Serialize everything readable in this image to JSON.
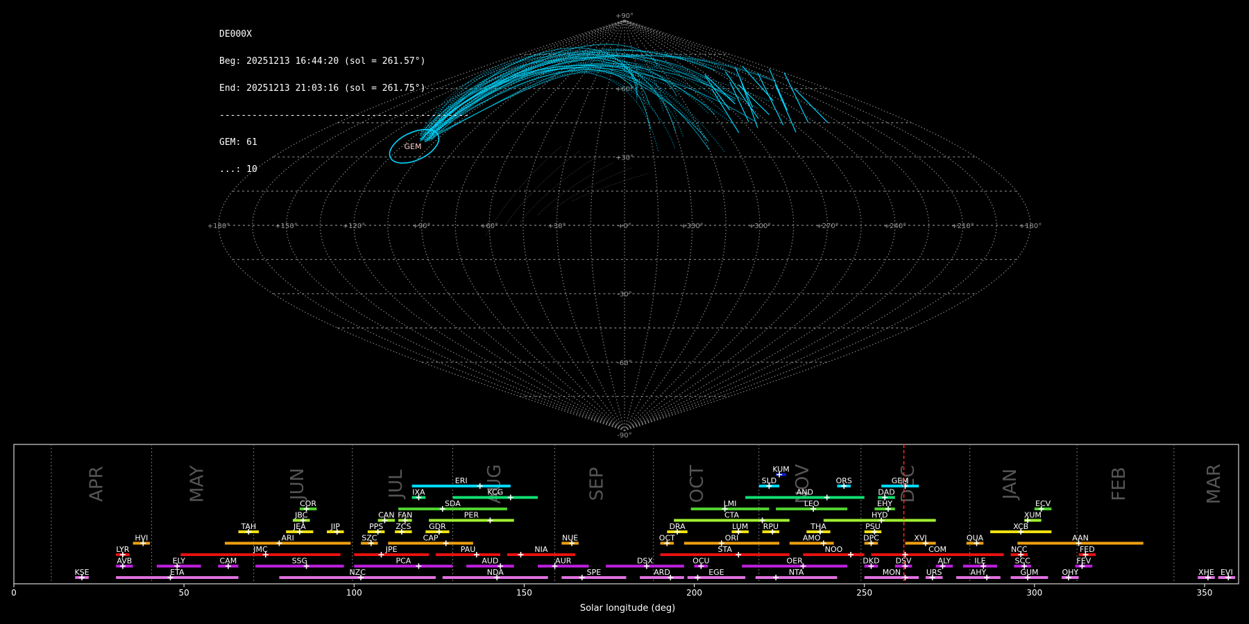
{
  "info": {
    "station": "DE000X",
    "beg": "Beg: 20251213 16:44:20 (sol = 261.57°)",
    "end": "End: 20251213 21:03:16 (sol = 261.75°)",
    "separator": "----------------------------------------------",
    "count_gem": "GEM: 61",
    "count_other": "...: 10"
  },
  "colors": {
    "background": "#000000",
    "meteor": "#00d8ff",
    "grid": "#888888",
    "now_line": "#ff2020",
    "timeline_text": "#ffffff",
    "month_label": "#555555"
  },
  "chart_data": [
    {
      "type": "scatter",
      "title": "",
      "projection": "sinusoidal",
      "lon_labels": [
        "+180°",
        "+150°",
        "+120°",
        "+90°",
        "+60°",
        "+30°",
        "+0°",
        "+330°",
        "+300°",
        "+270°",
        "+240°",
        "+210°",
        "+180°"
      ],
      "lat_labels": [
        "+90°",
        "+60°",
        "+30°",
        "-30°",
        "-60°",
        "-90°"
      ],
      "radiant": {
        "name": "GEM",
        "lon": 112,
        "lat": 33
      },
      "grid": true
    },
    {
      "type": "bar",
      "xlabel": "Solar longitude (deg)",
      "xlim": [
        0,
        360
      ],
      "xticks": [
        0,
        50,
        100,
        150,
        200,
        250,
        300,
        350
      ],
      "current_sol": 261.6,
      "months": [
        {
          "name": "APR",
          "x": 24.5
        },
        {
          "name": "MAY",
          "x": 54
        },
        {
          "name": "JUN",
          "x": 83.5
        },
        {
          "name": "JUL",
          "x": 112.5
        },
        {
          "name": "AUG",
          "x": 141.5
        },
        {
          "name": "SEP",
          "x": 171.5
        },
        {
          "name": "OCT",
          "x": 201
        },
        {
          "name": "NOV",
          "x": 232
        },
        {
          "name": "DEC",
          "x": 263
        },
        {
          "name": "JAN",
          "x": 293
        },
        {
          "name": "FEB",
          "x": 325
        },
        {
          "name": "MAR",
          "x": 353
        }
      ],
      "month_boundaries": [
        11,
        40.5,
        70.5,
        99.5,
        129,
        159,
        188,
        219,
        249,
        281,
        312.5,
        341
      ],
      "showers": [
        {
          "code": "KUM",
          "start": 224,
          "end": 227,
          "peak": 225,
          "row": 9,
          "color": "#0a1ed0"
        },
        {
          "code": "ERI",
          "start": 117,
          "end": 146,
          "peak": 137,
          "row": 8,
          "color": "#00d8ff"
        },
        {
          "code": "SLD",
          "start": 219,
          "end": 225,
          "peak": 222,
          "row": 8,
          "color": "#00d8ff"
        },
        {
          "code": "ORS",
          "start": 242,
          "end": 246,
          "peak": 244,
          "row": 8,
          "color": "#00d8ff"
        },
        {
          "code": "GEM",
          "start": 255,
          "end": 266,
          "peak": 262,
          "row": 8,
          "color": "#00d8ff"
        },
        {
          "code": "IXA",
          "start": 117,
          "end": 121,
          "peak": 119,
          "row": 7,
          "color": "#10e070"
        },
        {
          "code": "KCG",
          "start": 129,
          "end": 154,
          "peak": 146,
          "row": 7,
          "color": "#10e070"
        },
        {
          "code": "AND",
          "start": 215,
          "end": 250,
          "peak": 239,
          "row": 7,
          "color": "#10e070"
        },
        {
          "code": "DAD",
          "start": 254,
          "end": 259,
          "peak": 256,
          "row": 7,
          "color": "#10e070"
        },
        {
          "code": "COR",
          "start": 84,
          "end": 89,
          "peak": 86,
          "row": 6,
          "color": "#50d030"
        },
        {
          "code": "SDA",
          "start": 113,
          "end": 145,
          "peak": 126,
          "row": 6,
          "color": "#50d030"
        },
        {
          "code": "LMI",
          "start": 199,
          "end": 222,
          "peak": 209,
          "row": 6,
          "color": "#50d030"
        },
        {
          "code": "LEO",
          "start": 224,
          "end": 245,
          "peak": 235,
          "row": 6,
          "color": "#50d030"
        },
        {
          "code": "EHY",
          "start": 253,
          "end": 259,
          "peak": 257,
          "row": 6,
          "color": "#50d030"
        },
        {
          "code": "ECV",
          "start": 300,
          "end": 305,
          "peak": 302,
          "row": 6,
          "color": "#50d030"
        },
        {
          "code": "JBC",
          "start": 82,
          "end": 87,
          "peak": 85,
          "row": 5,
          "color": "#a0f030"
        },
        {
          "code": "CAN",
          "start": 107,
          "end": 112,
          "peak": 109,
          "row": 5,
          "color": "#a0f030"
        },
        {
          "code": "FAN",
          "start": 113,
          "end": 117,
          "peak": 115,
          "row": 5,
          "color": "#a0f030"
        },
        {
          "code": "PER",
          "start": 122,
          "end": 147,
          "peak": 140,
          "row": 5,
          "color": "#a0f030"
        },
        {
          "code": "CTA",
          "start": 194,
          "end": 228,
          "peak": 220,
          "row": 5,
          "color": "#a0f030"
        },
        {
          "code": "HYD",
          "start": 238,
          "end": 271,
          "peak": 255,
          "row": 5,
          "color": "#a0f030"
        },
        {
          "code": "XUM",
          "start": 297,
          "end": 302,
          "peak": 298,
          "row": 5,
          "color": "#a0f030"
        },
        {
          "code": "TAH",
          "start": 66,
          "end": 72,
          "peak": 69,
          "row": 4,
          "color": "#f0e010"
        },
        {
          "code": "JEA",
          "start": 80,
          "end": 88,
          "peak": 84,
          "row": 4,
          "color": "#f0e010"
        },
        {
          "code": "JIP",
          "start": 92,
          "end": 97,
          "peak": 95,
          "row": 4,
          "color": "#f0e010"
        },
        {
          "code": "PPS",
          "start": 104,
          "end": 109,
          "peak": 107,
          "row": 4,
          "color": "#f0e010"
        },
        {
          "code": "ZCS",
          "start": 112,
          "end": 117,
          "peak": 114,
          "row": 4,
          "color": "#f0e010"
        },
        {
          "code": "GDR",
          "start": 121,
          "end": 128,
          "peak": 125,
          "row": 4,
          "color": "#f0e010"
        },
        {
          "code": "DRA",
          "start": 192,
          "end": 198,
          "peak": 195,
          "row": 4,
          "color": "#f0e010"
        },
        {
          "code": "LUM",
          "start": 211,
          "end": 216,
          "peak": 213,
          "row": 4,
          "color": "#f0e010"
        },
        {
          "code": "RPU",
          "start": 220,
          "end": 225,
          "peak": 223,
          "row": 4,
          "color": "#f0e010"
        },
        {
          "code": "THA",
          "start": 233,
          "end": 240,
          "peak": 237,
          "row": 4,
          "color": "#f0e010"
        },
        {
          "code": "PSU",
          "start": 250,
          "end": 255,
          "peak": 253,
          "row": 4,
          "color": "#f0e010"
        },
        {
          "code": "XCB",
          "start": 287,
          "end": 305,
          "peak": 296,
          "row": 4,
          "color": "#f0e010"
        },
        {
          "code": "HVI",
          "start": 35,
          "end": 40,
          "peak": 38,
          "row": 3,
          "color": "#f0a010"
        },
        {
          "code": "ARI",
          "start": 62,
          "end": 99,
          "peak": 78,
          "row": 3,
          "color": "#f0a010"
        },
        {
          "code": "SZC",
          "start": 102,
          "end": 107,
          "peak": 105,
          "row": 3,
          "color": "#f0a010"
        },
        {
          "code": "CAP",
          "start": 110,
          "end": 135,
          "peak": 127,
          "row": 3,
          "color": "#f0a010"
        },
        {
          "code": "NUE",
          "start": 161,
          "end": 166,
          "peak": 164,
          "row": 3,
          "color": "#f0a010"
        },
        {
          "code": "OCT",
          "start": 190,
          "end": 194,
          "peak": 192,
          "row": 3,
          "color": "#f0a010"
        },
        {
          "code": "ORI",
          "start": 197,
          "end": 225,
          "peak": 208,
          "row": 3,
          "color": "#f0a010"
        },
        {
          "code": "AMO",
          "start": 228,
          "end": 241,
          "peak": 238,
          "row": 3,
          "color": "#f0a010"
        },
        {
          "code": "DPC",
          "start": 250,
          "end": 254,
          "peak": 252,
          "row": 3,
          "color": "#f0a010"
        },
        {
          "code": "XVI",
          "start": 262,
          "end": 271,
          "peak": 268,
          "row": 3,
          "color": "#f0a010"
        },
        {
          "code": "QUA",
          "start": 280,
          "end": 285,
          "peak": 283,
          "row": 3,
          "color": "#f0a010"
        },
        {
          "code": "AAN",
          "start": 295,
          "end": 332,
          "peak": 313,
          "row": 3,
          "color": "#f0a010"
        },
        {
          "code": "LYR",
          "start": 30,
          "end": 34,
          "peak": 32,
          "row": 2,
          "color": "#e81010"
        },
        {
          "code": "JMC",
          "start": 49,
          "end": 96,
          "peak": 74,
          "row": 2,
          "color": "#e81010"
        },
        {
          "code": "JPE",
          "start": 100,
          "end": 122,
          "peak": 108,
          "row": 2,
          "color": "#e81010"
        },
        {
          "code": "PAU",
          "start": 124,
          "end": 143,
          "peak": 136,
          "row": 2,
          "color": "#e81010"
        },
        {
          "code": "NIA",
          "start": 145,
          "end": 165,
          "peak": 149,
          "row": 2,
          "color": "#e81010"
        },
        {
          "code": "STA",
          "start": 190,
          "end": 228,
          "peak": 213,
          "row": 2,
          "color": "#e81010"
        },
        {
          "code": "NOO",
          "start": 232,
          "end": 250,
          "peak": 246,
          "row": 2,
          "color": "#e81010"
        },
        {
          "code": "COM",
          "start": 252,
          "end": 291,
          "peak": 262,
          "row": 2,
          "color": "#e81010"
        },
        {
          "code": "NCC",
          "start": 293,
          "end": 298,
          "peak": 296,
          "row": 2,
          "color": "#e81010"
        },
        {
          "code": "FED",
          "start": 313,
          "end": 318,
          "peak": 315,
          "row": 2,
          "color": "#e81010"
        },
        {
          "code": "AVB",
          "start": 30,
          "end": 35,
          "peak": 32,
          "row": 1,
          "color": "#c020e0"
        },
        {
          "code": "ELY",
          "start": 42,
          "end": 55,
          "peak": 48,
          "row": 1,
          "color": "#c020e0"
        },
        {
          "code": "CAM",
          "start": 60,
          "end": 66,
          "peak": 63,
          "row": 1,
          "color": "#c020e0"
        },
        {
          "code": "SSG",
          "start": 71,
          "end": 97,
          "peak": 86,
          "row": 1,
          "color": "#c020e0"
        },
        {
          "code": "PCA",
          "start": 100,
          "end": 129,
          "peak": 119,
          "row": 1,
          "color": "#c020e0"
        },
        {
          "code": "AUD",
          "start": 133,
          "end": 147,
          "peak": 143,
          "row": 1,
          "color": "#c020e0"
        },
        {
          "code": "AUR",
          "start": 154,
          "end": 169,
          "peak": 159,
          "row": 1,
          "color": "#c020e0"
        },
        {
          "code": "DSX",
          "start": 174,
          "end": 197,
          "peak": 186,
          "row": 1,
          "color": "#c020e0"
        },
        {
          "code": "OCU",
          "start": 200,
          "end": 204,
          "peak": 202,
          "row": 1,
          "color": "#c020e0"
        },
        {
          "code": "OER",
          "start": 214,
          "end": 245,
          "peak": 232,
          "row": 1,
          "color": "#c020e0"
        },
        {
          "code": "DKD",
          "start": 250,
          "end": 254,
          "peak": 252,
          "row": 1,
          "color": "#c020e0"
        },
        {
          "code": "DSV",
          "start": 259,
          "end": 264,
          "peak": 262,
          "row": 1,
          "color": "#c020e0"
        },
        {
          "code": "ALY",
          "start": 271,
          "end": 276,
          "peak": 273,
          "row": 1,
          "color": "#c020e0"
        },
        {
          "code": "ILE",
          "start": 279,
          "end": 289,
          "peak": 285,
          "row": 1,
          "color": "#c020e0"
        },
        {
          "code": "SCC",
          "start": 294,
          "end": 299,
          "peak": 297,
          "row": 1,
          "color": "#c020e0"
        },
        {
          "code": "FEV",
          "start": 312,
          "end": 317,
          "peak": 314,
          "row": 1,
          "color": "#c020e0"
        },
        {
          "code": "KSE",
          "start": 18,
          "end": 22,
          "peak": 20,
          "row": 0,
          "color": "#e070e0"
        },
        {
          "code": "ETA",
          "start": 30,
          "end": 66,
          "peak": 46,
          "row": 0,
          "color": "#e070e0"
        },
        {
          "code": "NZC",
          "start": 78,
          "end": 124,
          "peak": 102,
          "row": 0,
          "color": "#e070e0"
        },
        {
          "code": "NDA",
          "start": 126,
          "end": 157,
          "peak": 142,
          "row": 0,
          "color": "#e070e0"
        },
        {
          "code": "SPE",
          "start": 161,
          "end": 180,
          "peak": 167,
          "row": 0,
          "color": "#e070e0"
        },
        {
          "code": "ARD",
          "start": 184,
          "end": 197,
          "peak": 193,
          "row": 0,
          "color": "#e070e0"
        },
        {
          "code": "EGE",
          "start": 198,
          "end": 215,
          "peak": 201,
          "row": 0,
          "color": "#e070e0"
        },
        {
          "code": "NTA",
          "start": 218,
          "end": 242,
          "peak": 224,
          "row": 0,
          "color": "#e070e0"
        },
        {
          "code": "MON",
          "start": 250,
          "end": 266,
          "peak": 262,
          "row": 0,
          "color": "#e070e0"
        },
        {
          "code": "URS",
          "start": 268,
          "end": 273,
          "peak": 270,
          "row": 0,
          "color": "#e070e0"
        },
        {
          "code": "AHY",
          "start": 277,
          "end": 290,
          "peak": 286,
          "row": 0,
          "color": "#e070e0"
        },
        {
          "code": "GUM",
          "start": 293,
          "end": 304,
          "peak": 298,
          "row": 0,
          "color": "#e070e0"
        },
        {
          "code": "OHY",
          "start": 308,
          "end": 313,
          "peak": 310,
          "row": 0,
          "color": "#e070e0"
        },
        {
          "code": "XHE",
          "start": 348,
          "end": 353,
          "peak": 351,
          "row": 0,
          "color": "#e070e0"
        },
        {
          "code": "EVI",
          "start": 354,
          "end": 359,
          "peak": 357,
          "row": 0,
          "color": "#e070e0"
        }
      ]
    }
  ]
}
